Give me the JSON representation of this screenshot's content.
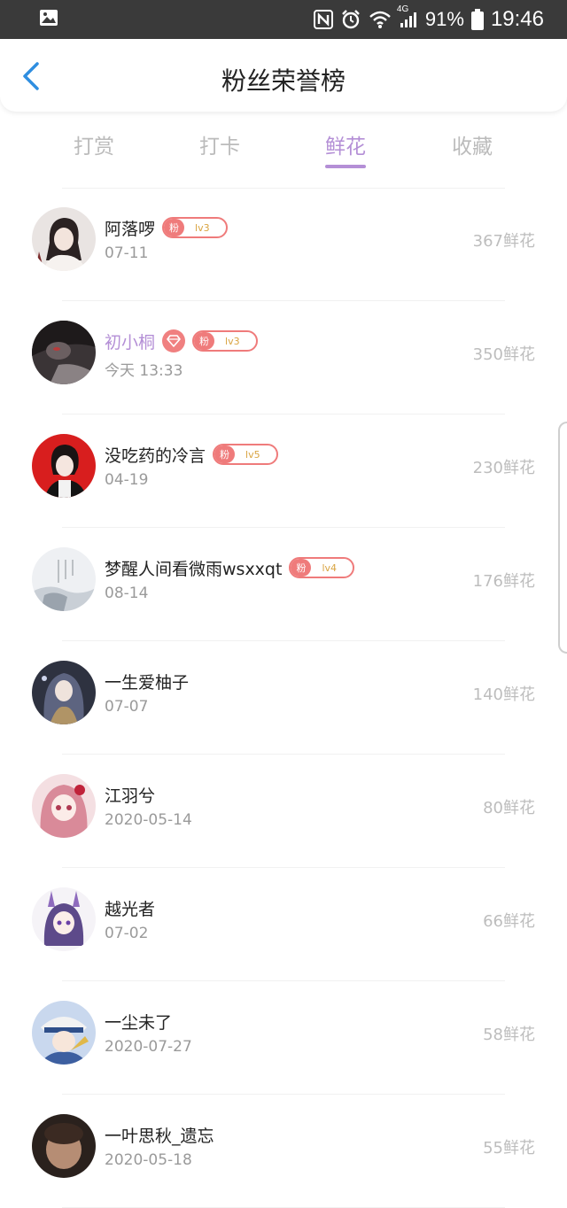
{
  "status_bar": {
    "battery": "91%",
    "time": "19:46",
    "network": "4G",
    "left_icon": "image-notification-icon",
    "right_icons": [
      "nfc-icon",
      "alarm-icon",
      "wifi-icon",
      "signal-icon",
      "battery-icon"
    ]
  },
  "header": {
    "title": "粉丝荣誉榜",
    "back_icon": "chevron-left-icon",
    "accent": "#2f8ee0"
  },
  "tabs": [
    {
      "label": "打赏",
      "active": false
    },
    {
      "label": "打卡",
      "active": false
    },
    {
      "label": "鲜花",
      "active": true
    },
    {
      "label": "收藏",
      "active": false
    }
  ],
  "colors": {
    "active_tab": "#b48fd6",
    "badge": "#ef7b7b",
    "level_text": "#d9a441",
    "count_text": "#bdbdbd"
  },
  "fans": [
    {
      "name": "阿落啰",
      "date": "07-11",
      "count": "367鲜花",
      "badge": {
        "label": "粉",
        "level": "lv3"
      },
      "vip": false
    },
    {
      "name": "初小桐",
      "date": "今天 13:33",
      "count": "350鲜花",
      "badge": {
        "label": "粉",
        "level": "lv3"
      },
      "vip": true,
      "vip_icon": "diamond-icon"
    },
    {
      "name": "没吃药的冷言",
      "date": "04-19",
      "count": "230鲜花",
      "badge": {
        "label": "粉",
        "level": "lv5"
      },
      "vip": false
    },
    {
      "name": "梦醒人间看微雨wsxxqt",
      "date": "08-14",
      "count": "176鲜花",
      "badge": {
        "label": "粉",
        "level": "lv4"
      },
      "vip": false
    },
    {
      "name": "一生爱柚子",
      "date": "07-07",
      "count": "140鲜花",
      "badge": null,
      "vip": false
    },
    {
      "name": "江羽兮",
      "date": "2020-05-14",
      "count": "80鲜花",
      "badge": null,
      "vip": false
    },
    {
      "name": "越光者",
      "date": "07-02",
      "count": "66鲜花",
      "badge": null,
      "vip": false
    },
    {
      "name": "一尘未了",
      "date": "2020-07-27",
      "count": "58鲜花",
      "badge": null,
      "vip": false
    },
    {
      "name": "一叶思秋_遗忘",
      "date": "2020-05-18",
      "count": "55鲜花",
      "badge": null,
      "vip": false
    }
  ]
}
